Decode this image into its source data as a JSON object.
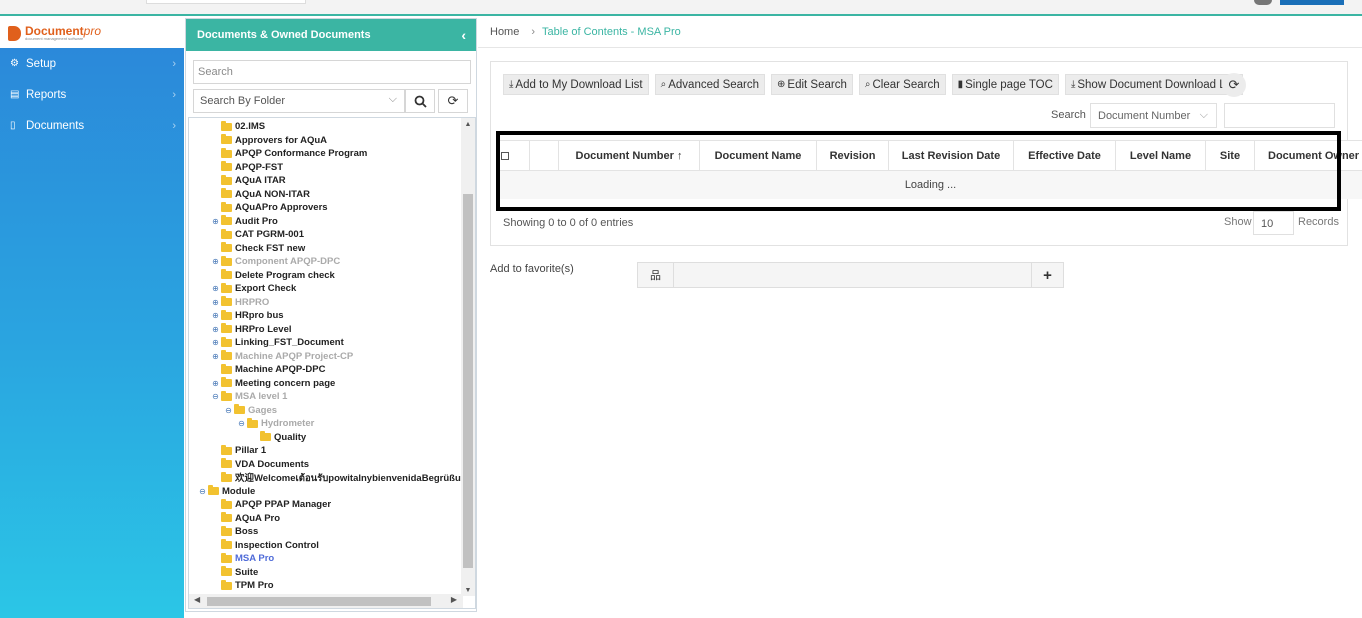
{
  "logo": {
    "brand": "Document",
    "brand_suffix": "pro",
    "tagline": "document management software"
  },
  "nav": {
    "items": [
      {
        "label": "Setup",
        "icon": "gears-icon"
      },
      {
        "label": "Reports",
        "icon": "report-icon"
      },
      {
        "label": "Documents",
        "icon": "document-icon"
      }
    ]
  },
  "folder_panel": {
    "title": "Documents & Owned Documents",
    "search_placeholder": "Search",
    "filter_value": "Search By Folder",
    "tree": [
      {
        "label": "02.IMS",
        "level": 1,
        "toggle": "",
        "state": ""
      },
      {
        "label": "Approvers for AQuA",
        "level": 1,
        "toggle": "",
        "state": ""
      },
      {
        "label": "APQP Conformance Program",
        "level": 1,
        "toggle": "",
        "state": ""
      },
      {
        "label": "APQP-FST",
        "level": 1,
        "toggle": "",
        "state": ""
      },
      {
        "label": "AQuA ITAR",
        "level": 1,
        "toggle": "",
        "state": ""
      },
      {
        "label": "AQuA NON-ITAR",
        "level": 1,
        "toggle": "",
        "state": ""
      },
      {
        "label": "AQuAPro Approvers",
        "level": 1,
        "toggle": "",
        "state": ""
      },
      {
        "label": "Audit Pro",
        "level": 1,
        "toggle": "⊕",
        "state": ""
      },
      {
        "label": "CAT PGRM-001",
        "level": 1,
        "toggle": "",
        "state": ""
      },
      {
        "label": "Check FST new",
        "level": 1,
        "toggle": "",
        "state": ""
      },
      {
        "label": "Component APQP-DPC",
        "level": 1,
        "toggle": "⊕",
        "state": "dim"
      },
      {
        "label": "Delete Program check",
        "level": 1,
        "toggle": "",
        "state": ""
      },
      {
        "label": "Export Check",
        "level": 1,
        "toggle": "⊕",
        "state": ""
      },
      {
        "label": "HRPRO",
        "level": 1,
        "toggle": "⊕",
        "state": "dim"
      },
      {
        "label": "HRpro bus",
        "level": 1,
        "toggle": "⊕",
        "state": ""
      },
      {
        "label": "HRPro Level",
        "level": 1,
        "toggle": "⊕",
        "state": ""
      },
      {
        "label": "Linking_FST_Document",
        "level": 1,
        "toggle": "⊕",
        "state": ""
      },
      {
        "label": "Machine APQP Project-CP",
        "level": 1,
        "toggle": "⊕",
        "state": "dim"
      },
      {
        "label": "Machine APQP-DPC",
        "level": 1,
        "toggle": "",
        "state": ""
      },
      {
        "label": "Meeting concern page",
        "level": 1,
        "toggle": "⊕",
        "state": ""
      },
      {
        "label": "MSA level 1",
        "level": 1,
        "toggle": "⊖",
        "state": "dim"
      },
      {
        "label": "Gages",
        "level": 2,
        "toggle": "⊖",
        "state": "dim"
      },
      {
        "label": "Hydrometer",
        "level": 3,
        "toggle": "⊖",
        "state": "dim"
      },
      {
        "label": "Quality",
        "level": 4,
        "toggle": "",
        "state": ""
      },
      {
        "label": "Pillar 1",
        "level": 1,
        "toggle": "",
        "state": ""
      },
      {
        "label": "VDA Documents",
        "level": 1,
        "toggle": "",
        "state": ""
      },
      {
        "label": "欢迎Welcomeเต้อนรับpowitalnybienvenidaBegrüßu",
        "level": 1,
        "toggle": "",
        "state": ""
      },
      {
        "label": "Module",
        "level": 0,
        "toggle": "⊖",
        "state": ""
      },
      {
        "label": "APQP PPAP Manager",
        "level": 1,
        "toggle": "",
        "state": ""
      },
      {
        "label": "AQuA Pro",
        "level": 1,
        "toggle": "",
        "state": ""
      },
      {
        "label": "Boss",
        "level": 1,
        "toggle": "",
        "state": ""
      },
      {
        "label": "Inspection Control",
        "level": 1,
        "toggle": "",
        "state": ""
      },
      {
        "label": "MSA Pro",
        "level": 1,
        "toggle": "",
        "state": "sel"
      },
      {
        "label": "Suite",
        "level": 1,
        "toggle": "",
        "state": ""
      },
      {
        "label": "TPM Pro",
        "level": 1,
        "toggle": "",
        "state": ""
      }
    ]
  },
  "breadcrumb": {
    "home": "Home",
    "current": "Table of Contents - MSA Pro"
  },
  "toolbar": {
    "buttons": [
      {
        "label": "Add to My Download List",
        "icon": "download-icon"
      },
      {
        "label": "Advanced Search",
        "icon": "search-icon"
      },
      {
        "label": "Edit Search",
        "icon": "zoom-in-icon"
      },
      {
        "label": "Clear Search",
        "icon": "search-icon"
      },
      {
        "label": "Single page TOC",
        "icon": "file-icon"
      },
      {
        "label": "Show Document Download List",
        "icon": "download-icon"
      }
    ]
  },
  "search": {
    "label": "Search",
    "field": "Document Number",
    "value": ""
  },
  "table": {
    "columns": [
      {
        "label": ""
      },
      {
        "label": ""
      },
      {
        "label": "Document Number ↑"
      },
      {
        "label": "Document Name"
      },
      {
        "label": "Revision"
      },
      {
        "label": "Last Revision Date"
      },
      {
        "label": "Effective Date"
      },
      {
        "label": "Level Name"
      },
      {
        "label": "Site"
      },
      {
        "label": "Document Owner"
      }
    ],
    "loading_text": "Loading ...",
    "entries_text": "Showing 0 to 0 of 0 entries",
    "show_label": "Show",
    "page_size": "10",
    "records_label": "Records"
  },
  "favorites": {
    "label": "Add to favorite(s)",
    "value": ""
  },
  "colors": {
    "accent": "#3bb5a3",
    "nav_top": "#2b86d9",
    "nav_bottom": "#2bc6e6",
    "brand": "#e0601c"
  }
}
